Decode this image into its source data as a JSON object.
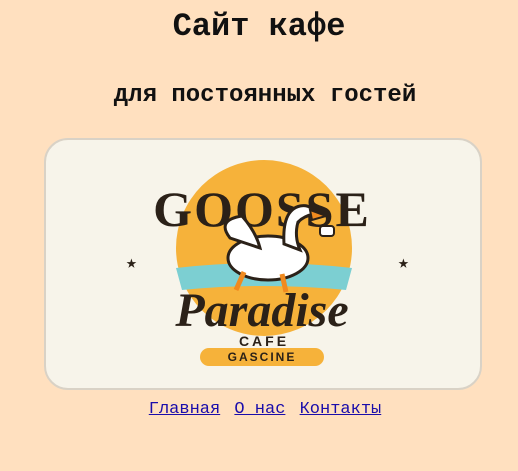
{
  "page": {
    "title": "Сайт кафе",
    "subtitle": "для постоянных гостей"
  },
  "logo": {
    "top_text": "GOOSSE",
    "main_text": "Paradise",
    "cafe_text": "CAFE",
    "ribbon_text": "GASCINE",
    "colors": {
      "orange": "#f4a52a",
      "dark": "#2b2118",
      "teal": "#7ccfd2",
      "cream": "#f7f4ea"
    }
  },
  "nav": {
    "items": [
      {
        "label": "Главная"
      },
      {
        "label": "О нас"
      },
      {
        "label": "Контакты"
      }
    ]
  }
}
